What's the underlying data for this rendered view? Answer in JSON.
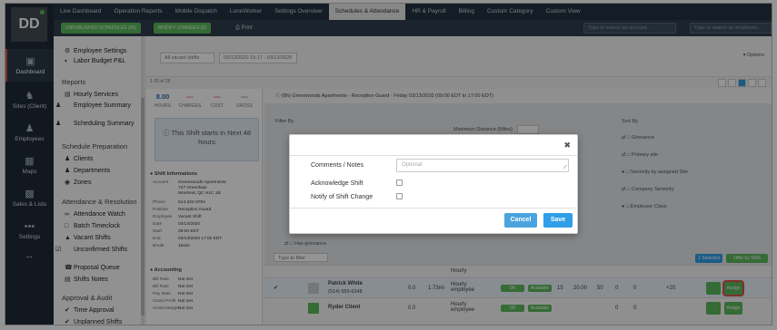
{
  "colors": {
    "accent": "#5cb85c",
    "primary": "#2f9fe8",
    "nav": "#243241",
    "danger": "#d9534f"
  },
  "logo": {
    "initials": "DD"
  },
  "rail": [
    {
      "label": "Dashboard",
      "icon": "monitor-icon"
    },
    {
      "label": "Sites (Client)",
      "icon": "sites-icon"
    },
    {
      "label": "Employees",
      "icon": "employees-icon"
    },
    {
      "label": "Maps",
      "icon": "map-icon"
    },
    {
      "label": "Sales & Lists",
      "icon": "chart-icon"
    },
    {
      "label": "Settings",
      "icon": "dots-icon"
    }
  ],
  "topnav": [
    "Live Dashboard",
    "Operation Reports",
    "Mobile Dispatch",
    "LoneWorker",
    "Settings Overview",
    "Schedules & Attendance",
    "HR & Payroll",
    "Billing",
    "Custom Category",
    "Custom View"
  ],
  "topnav_active": 5,
  "subbar": {
    "published": "UNPUBLISHED SCHEDULES (26)",
    "modify": "MODIFY CHANGES (0)",
    "print": "Print",
    "search_account": "Type to search an account...",
    "search_employee": "Type to search an employee..."
  },
  "menu": {
    "top_items": [
      "Employee Settings",
      "Labor Budget P&L"
    ],
    "reports_heading": "Reports",
    "report_items": [
      "Hourly Services",
      "Employee Summary",
      "Scheduling Summary"
    ],
    "prep_heading": "Schedule Preparation",
    "prep_items": [
      "Clients",
      "Departments",
      "Zones"
    ],
    "att_heading": "Attendance & Resolution",
    "att_items": [
      "Attendance Watch",
      "Batch Timeclock",
      "Vacant Shifts",
      "Unconfirmed Shifts",
      "Proposal Queue",
      "Shifts Notes"
    ],
    "approval_heading": "Approval & Audit",
    "approval_items": [
      "Time Approval",
      "Unplanned Shifts"
    ]
  },
  "toolbar": {
    "filter_select": "All vacant shifts",
    "date_range": "03/12/2020 15:17 - 03/13/2020",
    "options": "Options",
    "count": "1-25 of 26"
  },
  "shift": {
    "stats": [
      {
        "value": "8.00",
        "label": "HOURS"
      },
      {
        "value": "---",
        "label": "CHARGES"
      },
      {
        "value": "---",
        "label": "COST"
      },
      {
        "value": "---",
        "label": "GROSS"
      }
    ],
    "notice": "This Shift starts in Next 48 hours",
    "info_heading": "Shift Informations",
    "info": [
      {
        "k": "Account",
        "v": "Greenwoods Apartments"
      },
      {
        "k": "",
        "v": "727 Greenhaw"
      },
      {
        "k": "",
        "v": "Montreal, QC H1C 1B"
      },
      {
        "k": "Phone",
        "v": "514-222-8784"
      },
      {
        "k": "Position",
        "v": "Reception Guard"
      },
      {
        "k": "Employee",
        "v": "Vacant Shift"
      },
      {
        "k": "Date",
        "v": "03/13/2020"
      },
      {
        "k": "Start",
        "v": "09:00 EDT"
      },
      {
        "k": "End",
        "v": "03/13/2020 17:00 EDT"
      },
      {
        "k": "Break",
        "v": "15min"
      }
    ],
    "acc_heading": "Accounting",
    "accounting": [
      {
        "k": "Bill Rate",
        "v": "Not Set"
      },
      {
        "k": "Bill Rate",
        "v": "Not Set"
      },
      {
        "k": "Pay Rate",
        "v": "Not Set"
      },
      {
        "k": "Gross Profit",
        "v": "Not Set"
      },
      {
        "k": "Gross Margin",
        "v": "Not Set"
      }
    ]
  },
  "detail": {
    "header": "(8h) Greenwoods Apartments - Reception Guard · Friday 03/13/2020 (09:00 EDT to 17:00 EDT)",
    "filter_by": "Filter By",
    "max_distance": "Maximum Distance (Miles)",
    "sort_by": "Sort By",
    "sort_items": [
      "Grievance",
      "Primary site",
      "Seniority by assigned Site",
      "Company Seniority",
      "Employee Class"
    ],
    "has_grievance": "Has grievance",
    "search_placeholder": "Type to filter",
    "selected": "1 Selected",
    "offer_sms": "Offer by SMS",
    "rows": [
      {
        "name": "Patrick White",
        "phone": "(514) 555-6348",
        "distance": "0.0",
        "time": "1.73mi",
        "type": "Hourly employee",
        "status": "OK",
        "avail": "Available",
        "n1": "15",
        "n2": "20.00",
        "n3": "50",
        "n4": "0",
        "n5": "0",
        "score": "+20",
        "action": "Assign"
      },
      {
        "name": "Ryder Client",
        "phone": "",
        "distance": "0.0",
        "time": "",
        "type": "Hourly employee",
        "status": "OK",
        "avail": "Available",
        "n1": "",
        "n2": "",
        "n3": "",
        "n4": "0",
        "n5": "0",
        "score": "",
        "action": "Assign"
      }
    ]
  },
  "modal": {
    "comments_label": "Comments / Notes",
    "comments_placeholder": "Optional",
    "ack_label": "Acknowledge Shift",
    "notify_label": "Notify of Shift Change",
    "cancel": "Cancel",
    "save": "Save"
  }
}
